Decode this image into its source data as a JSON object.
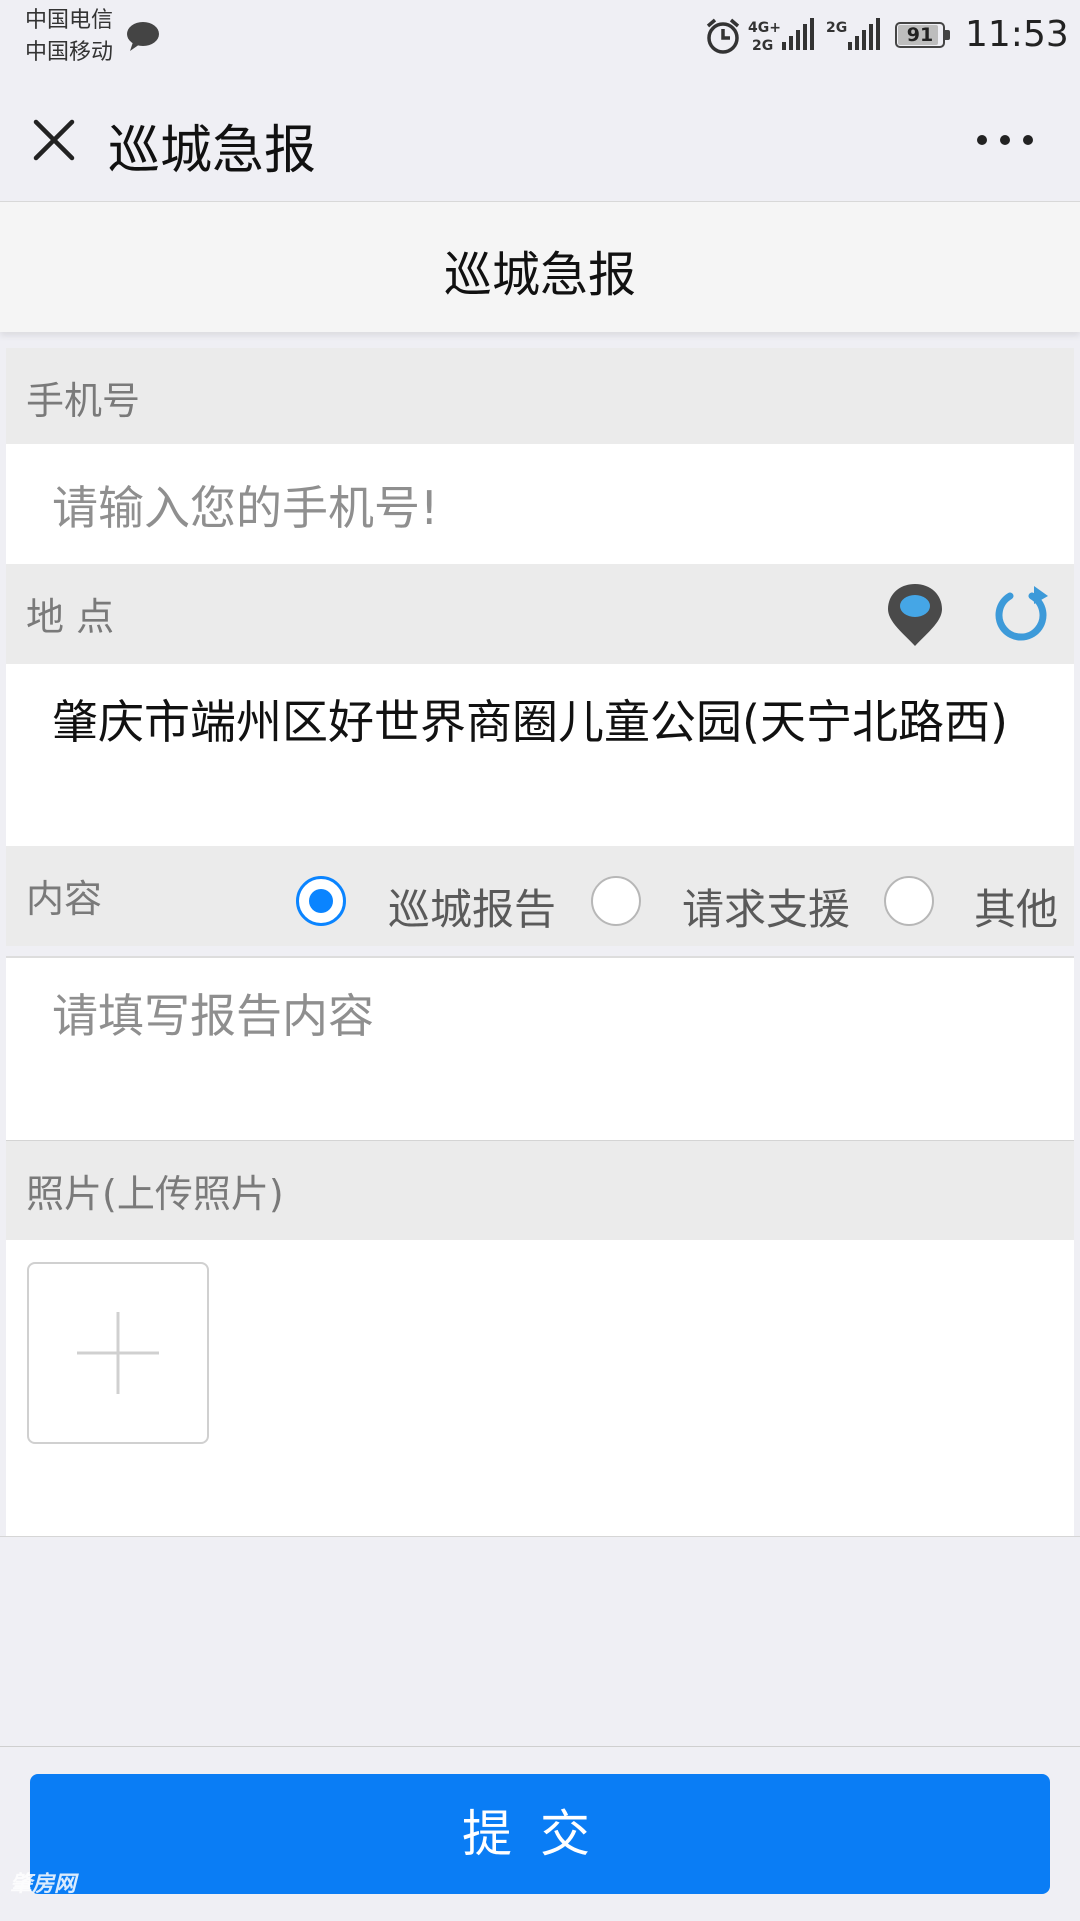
{
  "status_bar": {
    "carrier_1": "中国电信",
    "carrier_2": "中国移动",
    "network_1": "4G+",
    "network_1b": "2G",
    "network_2": "2G",
    "battery": "91",
    "battery_level_percent": 91,
    "time": "11:53"
  },
  "nav": {
    "title": "巡城急报"
  },
  "page": {
    "title": "巡城急报"
  },
  "form": {
    "phone": {
      "label": "手机号",
      "placeholder": "请输入您的手机号!"
    },
    "location": {
      "label": "地 点",
      "value": "肇庆市端州区好世界商圈儿童公园(天宁北路西)"
    },
    "content": {
      "label": "内容",
      "options": [
        "巡城报告",
        "请求支援",
        "其他"
      ],
      "selected": "巡城报告",
      "placeholder": "请填写报告内容"
    },
    "photo": {
      "label": "照片(上传照片)"
    }
  },
  "submit_label": "提交",
  "watermark": "肇房网",
  "colors": {
    "accent": "#0a84ff",
    "submit": "#0a7df5",
    "location_pin": "#4a4a4a",
    "pin_dot": "#45a6e6",
    "refresh": "#3d9ad9"
  }
}
